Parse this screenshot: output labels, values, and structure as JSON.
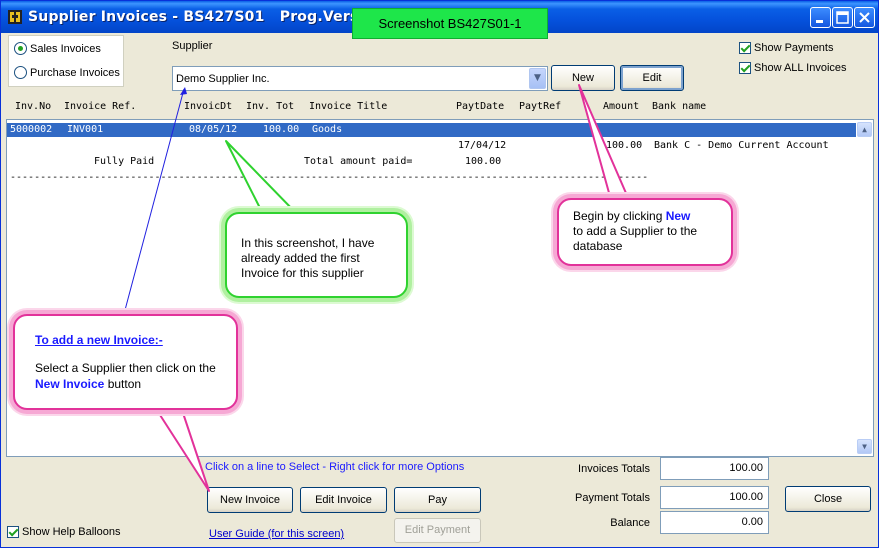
{
  "window": {
    "title": "Supplier Invoices - BS427S01   Prog.Version:-  5",
    "screenshot_tag": "Screenshot BS427S01-1"
  },
  "invoice_type": {
    "options": [
      "Sales Invoices",
      "Purchase Invoices"
    ],
    "selected": "Sales Invoices"
  },
  "supplier": {
    "label": "Supplier",
    "value": "Demo Supplier Inc.",
    "new_label": "New",
    "edit_label": "Edit"
  },
  "options": {
    "show_payments": "Show Payments",
    "show_all_invoices": "Show ALL Invoices"
  },
  "grid": {
    "headers": [
      "Inv.No",
      "Invoice Ref.",
      "InvoicDt",
      "Inv. Tot",
      "Invoice Title",
      "PaytDate",
      "PaytRef",
      "Amount",
      "Bank name"
    ],
    "invoice_row": {
      "inv_no": "5000002",
      "invoice_ref": "INV001",
      "invoice_date": "08/05/12",
      "inv_tot": "100.00",
      "invoice_title": "Goods"
    },
    "payment_row": {
      "payt_date": "17/04/12",
      "amount": "100.00",
      "bank_name": "Bank C - Demo Current Account"
    },
    "summary": {
      "status": "Fully Paid",
      "total_label": "Total amount paid=",
      "total_value": "100.00"
    },
    "separator": "----------------------------------------------------------------------------------------------------------"
  },
  "footer": {
    "hint": "Click on a line to Select - Right click for more Options",
    "new_invoice": "New Invoice",
    "edit_invoice": "Edit Invoice",
    "pay": "Pay",
    "edit_payment": "Edit Payment",
    "user_guide": "User Guide (for this screen)",
    "show_help_balloons": "Show Help Balloons",
    "invoices_totals_label": "Invoices Totals",
    "invoices_totals": "100.00",
    "payment_totals_label": "Payment Totals",
    "payment_totals": "100.00",
    "balance_label": "Balance",
    "balance": "0.00",
    "close": "Close"
  },
  "balloons": {
    "new_supplier": {
      "pre": "Begin by clicking ",
      "highlight": "New",
      "post": "to add a Supplier to the database"
    },
    "first_invoice": "In this screenshot, I have already added the first Invoice for this supplier",
    "add_invoice": {
      "title": "To add a new Invoice:-",
      "pre": "Select a Supplier then click on the ",
      "highlight": "New Invoice",
      "post": " button"
    }
  },
  "colors": {
    "titlebar": "#0a5fe6",
    "selection": "#316ac5",
    "tag_green": "#1ee64a",
    "balloon_pink": "#e2329a",
    "balloon_green": "#2fd22f",
    "hint_blue": "#1a1aff"
  }
}
